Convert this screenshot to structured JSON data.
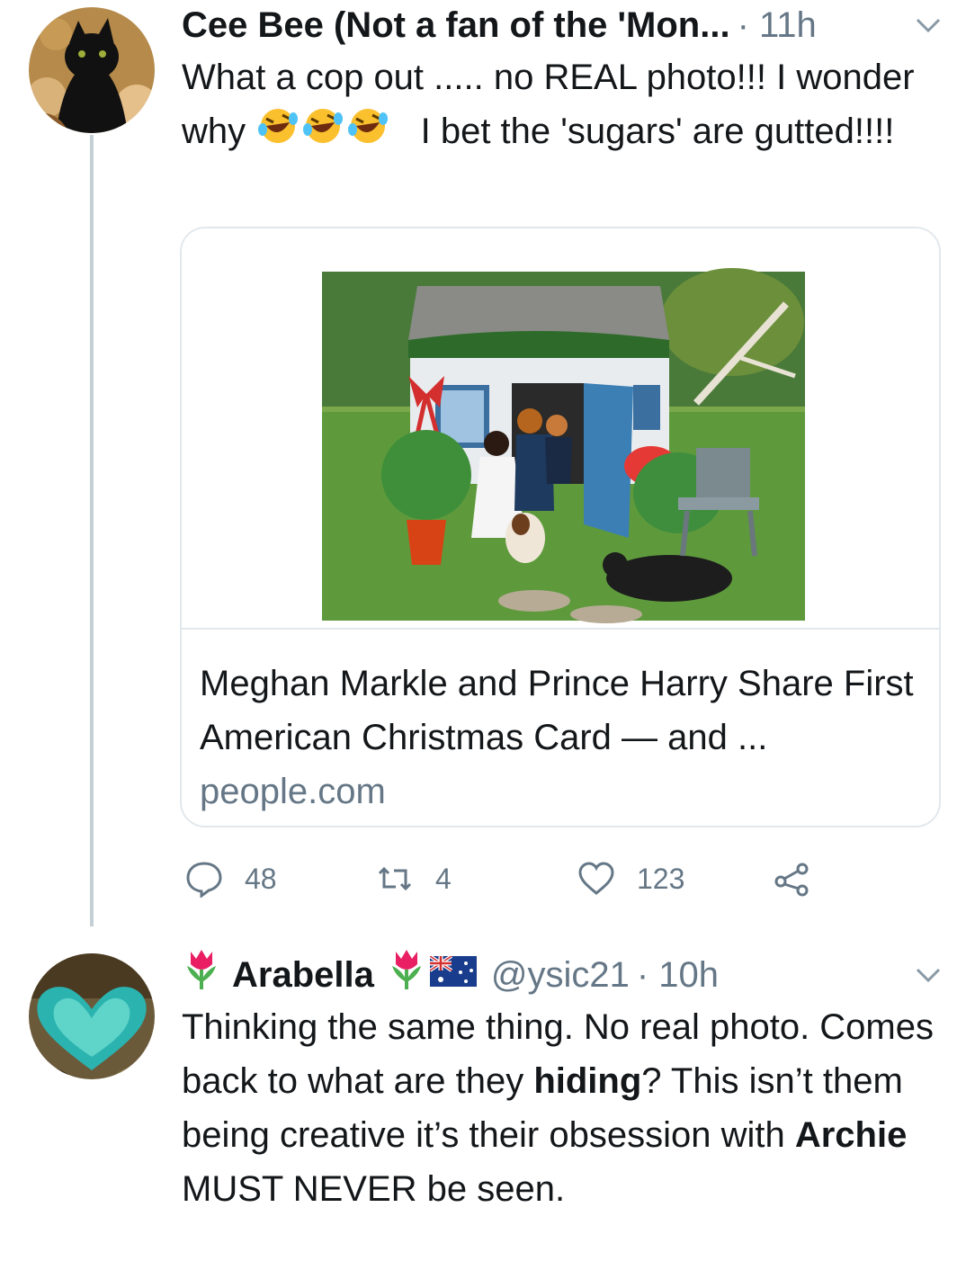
{
  "tweet1": {
    "author_name": "Cee Bee (Not a fan of the 'Mon...",
    "time": "· 11h",
    "text_part1": "What a cop out ..... no REAL photo!!! I wonder why",
    "text_part2": "I bet the 'sugars' are gutted!!!!",
    "emojis": [
      "rolling-on-floor-laughing-emoji",
      "rolling-on-floor-laughing-emoji",
      "rolling-on-floor-laughing-emoji"
    ],
    "card": {
      "title": "Meghan Markle and Prince Harry Share First American Christmas Card — and ...",
      "domain": "people.com"
    },
    "actions": {
      "replies": "48",
      "retweets": "4",
      "likes": "123"
    }
  },
  "tweet2": {
    "author_name": "Arabella",
    "handle": "@ysic21",
    "time": "· 10h",
    "name_emojis": [
      "tulip-emoji",
      "tulip-emoji",
      "australia-flag-emoji"
    ],
    "text_seg1": "Thinking the same thing. No real photo. Comes back to what are they ",
    "text_bold1": "hiding",
    "text_seg2": "? This isn’t them being creative it’s their obsession with ",
    "text_bold2": "Archie",
    "text_seg3": " MUST NEVER be seen."
  },
  "colors": {
    "primary_text": "#14171a",
    "secondary_text": "#657786",
    "border": "#e1e8ed",
    "thread_line": "#c4cfd6"
  }
}
